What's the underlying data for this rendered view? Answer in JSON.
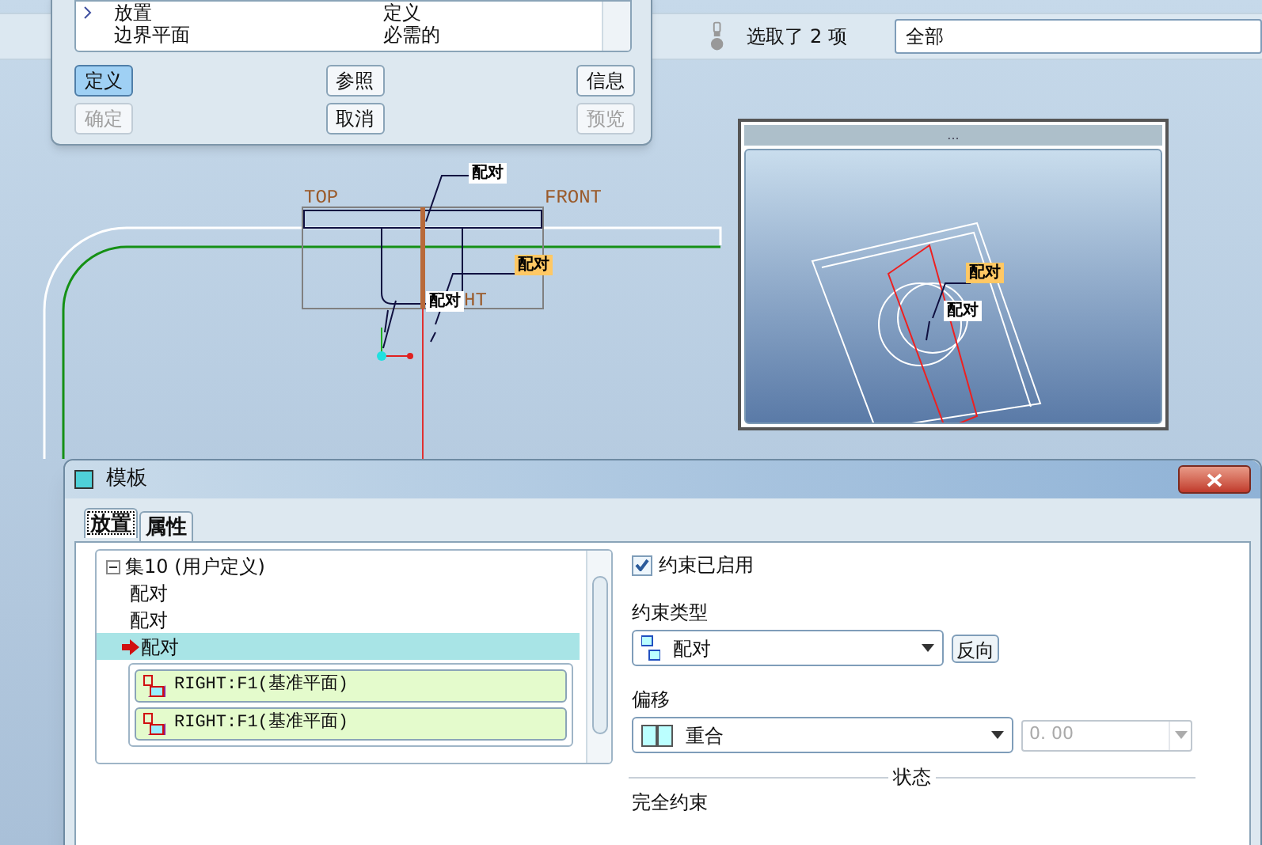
{
  "top_dialog": {
    "rows": [
      {
        "name": "放置",
        "status": "定义",
        "current": true
      },
      {
        "name": "边界平面",
        "status": "必需的",
        "current": false
      }
    ],
    "buttons": [
      {
        "label": "定义",
        "selected": true,
        "disabled": false
      },
      {
        "label": "参照",
        "selected": false,
        "disabled": false
      },
      {
        "label": "信息",
        "selected": false,
        "disabled": false
      },
      {
        "label": "确定",
        "selected": false,
        "disabled": true
      },
      {
        "label": "取消",
        "selected": false,
        "disabled": false
      },
      {
        "label": "预览",
        "selected": false,
        "disabled": true
      }
    ]
  },
  "toolbar": {
    "selection_text": "选取了 2 项",
    "filter": "全部"
  },
  "model_view": {
    "datum_labels": [
      "TOP",
      "FRONT",
      "HT"
    ],
    "tags": [
      {
        "text": "配对",
        "highlighted": false
      },
      {
        "text": "配对",
        "highlighted": true
      },
      {
        "text": "配对",
        "highlighted": false
      }
    ]
  },
  "preview_window": {
    "title": "...",
    "tags": [
      {
        "text": "配对",
        "highlighted": true
      },
      {
        "text": "配对",
        "highlighted": false
      }
    ]
  },
  "template_dialog": {
    "title": "模板",
    "tabs": [
      {
        "label": "放置",
        "selected": true
      },
      {
        "label": "属性",
        "selected": false
      }
    ],
    "tree": {
      "label": "集10 (用户定义)",
      "expanded": true,
      "children": [
        {
          "label": "配对",
          "selected": false
        },
        {
          "label": "配对",
          "selected": false
        },
        {
          "label": "配对",
          "selected": true,
          "references": [
            "RIGHT:F1(基准平面)",
            "RIGHT:F1(基准平面)"
          ]
        }
      ]
    },
    "constraint_enabled_label": "约束已启用",
    "constraint_enabled": true,
    "constraint_type_label": "约束类型",
    "constraint_type": "配对",
    "flip_button": "反向",
    "offset_label": "偏移",
    "offset_type": "重合",
    "offset_value": "0. 00",
    "status_label": "状态",
    "status": "完全约束"
  }
}
